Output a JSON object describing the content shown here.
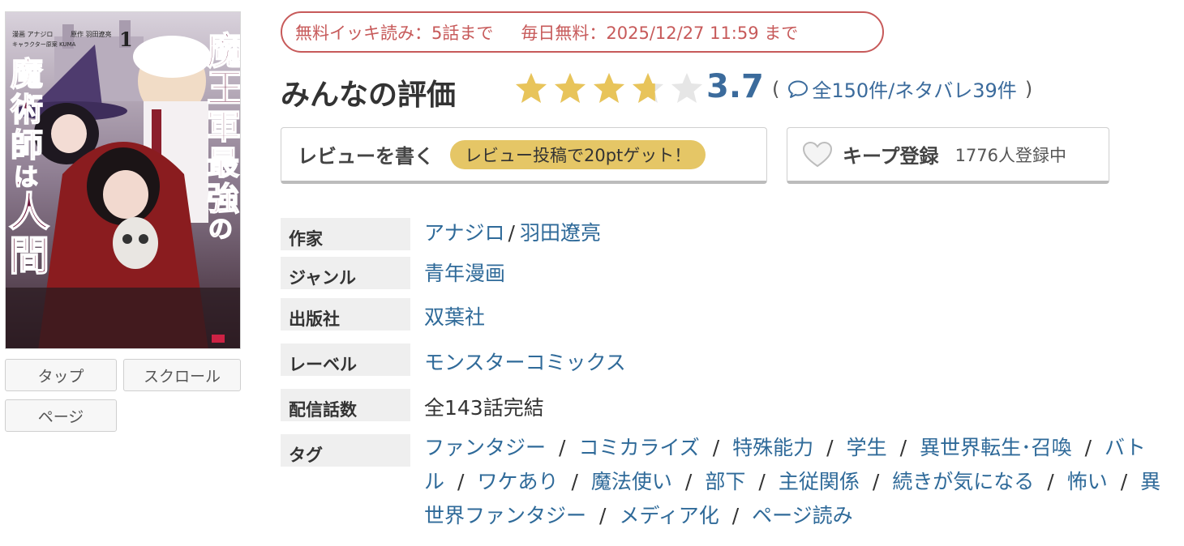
{
  "cover": {
    "title_lines": [
      "魔王軍最強の",
      "魔術師は",
      "人間だった"
    ],
    "volume": "1",
    "credits": [
      "漫画 アナジロ",
      "原作 羽田遼亮",
      "キャラクター原案 KUMA"
    ]
  },
  "viewer_buttons": {
    "tap": "タップ",
    "scroll": "スクロール",
    "page": "ページ"
  },
  "free_badge": {
    "ikki": "無料イッキ読み：5話まで",
    "daily": "毎日無料：2025/12/27 11:59 まで"
  },
  "rating": {
    "title": "みんなの評価",
    "score": "3.7",
    "score_value": 3.7,
    "max_stars": 5,
    "star_fill_color": "#e8c45a",
    "star_empty_color": "#e6e6e6",
    "open_paren": "(",
    "counts": "全150件/ネタバレ39件",
    "close_paren": ")"
  },
  "review_button": {
    "label": "レビューを書く",
    "promo": "レビュー投稿で20ptゲット！"
  },
  "keep_button": {
    "label": "キープ登録",
    "count": "1776人登録中"
  },
  "info": {
    "author_label": "作家",
    "authors": [
      "アナジロ",
      "羽田遼亮"
    ],
    "author_sep": "/",
    "genre_label": "ジャンル",
    "genre": "青年漫画",
    "publisher_label": "出版社",
    "publisher": "双葉社",
    "label_label": "レーベル",
    "label": "モンスターコミックス",
    "episodes_label": "配信話数",
    "episodes": "全143話完結",
    "tags_label": "タグ",
    "tags": [
      "ファンタジー",
      "コミカライズ",
      "特殊能力",
      "学生",
      "異世界転生･召喚",
      "バトル",
      "ワケあり",
      "魔法使い",
      "部下",
      "主従関係",
      "続きが気になる",
      "怖い",
      "異世界ファンタジー",
      "メディア化",
      "ページ読み"
    ],
    "tag_sep": "/"
  },
  "colors": {
    "badge_red": "#c75a5a",
    "link_blue": "#2f6a99",
    "score_blue": "#3b6b9c",
    "promo_gold": "#e5c666"
  }
}
